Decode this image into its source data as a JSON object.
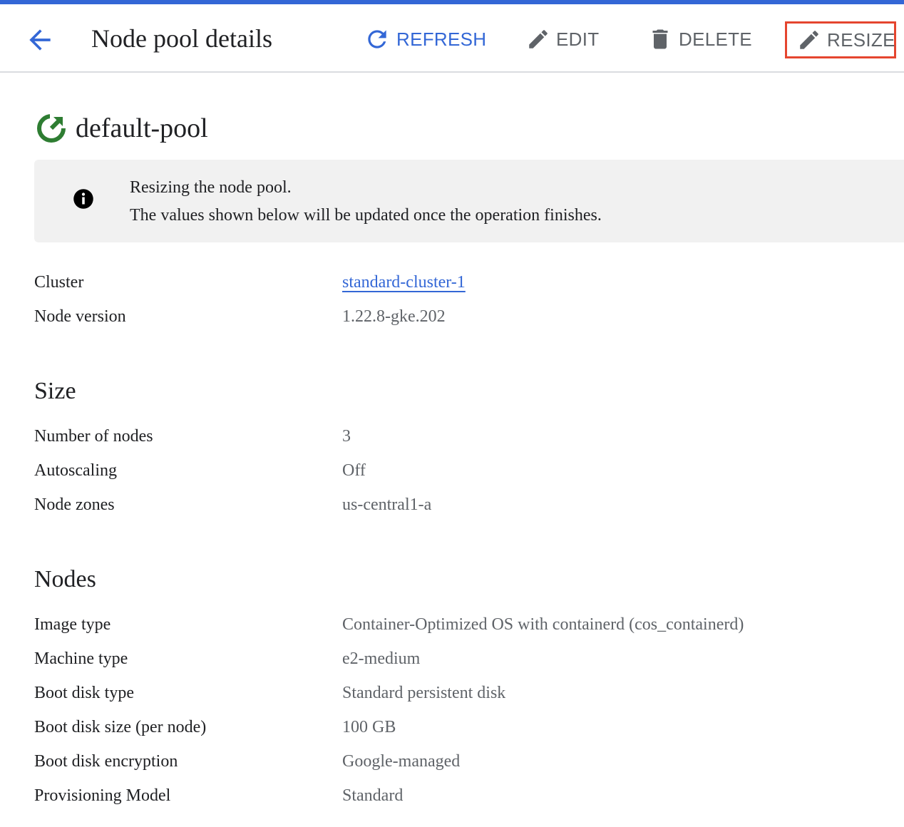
{
  "header": {
    "title": "Node pool details",
    "refresh_label": "REFRESH",
    "edit_label": "EDIT",
    "delete_label": "DELETE",
    "resize_label": "RESIZE"
  },
  "pool": {
    "name": "default-pool",
    "status_icon": "status-ok-icon"
  },
  "banner": {
    "line1": "Resizing the node pool.",
    "line2": "The values shown below will be updated once the operation finishes."
  },
  "details": [
    {
      "label": "Cluster",
      "value": "standard-cluster-1"
    },
    {
      "label": "Node version",
      "value": "1.22.8-gke.202"
    }
  ],
  "size": {
    "title": "Size",
    "rows": [
      {
        "label": "Number of nodes",
        "value": "3"
      },
      {
        "label": "Autoscaling",
        "value": "Off"
      },
      {
        "label": "Node zones",
        "value": "us-central1-a"
      }
    ]
  },
  "nodes": {
    "title": "Nodes",
    "rows": [
      {
        "label": "Image type",
        "value": "Container-Optimized OS with containerd (cos_containerd)"
      },
      {
        "label": "Machine type",
        "value": "e2-medium"
      },
      {
        "label": "Boot disk type",
        "value": "Standard persistent disk"
      },
      {
        "label": "Boot disk size (per node)",
        "value": "100 GB"
      },
      {
        "label": "Boot disk encryption",
        "value": "Google-managed"
      },
      {
        "label": "Provisioning Model",
        "value": "Standard"
      }
    ]
  },
  "colors": {
    "accent": "#3367d6",
    "status_ok": "#2e7d32",
    "highlight_border": "#e5452f"
  }
}
